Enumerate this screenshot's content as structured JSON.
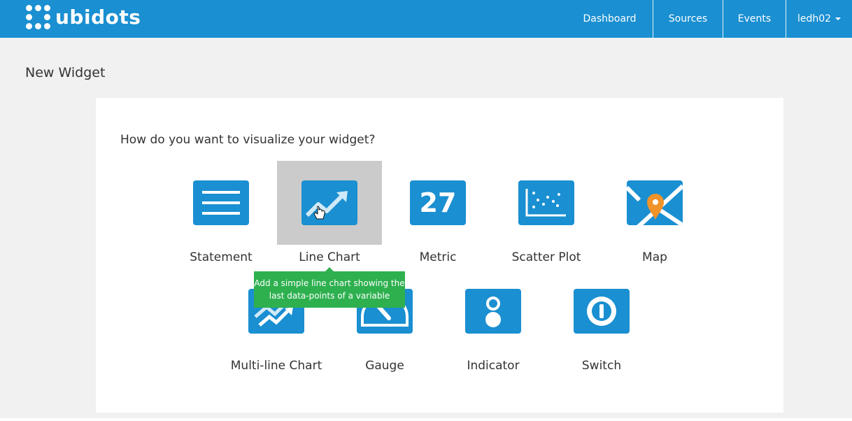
{
  "brand": {
    "name": "ubidots"
  },
  "nav": {
    "items": [
      {
        "label": "Dashboard"
      },
      {
        "label": "Sources"
      },
      {
        "label": "Events"
      },
      {
        "label": "ledh02"
      }
    ]
  },
  "page": {
    "title": "New Widget"
  },
  "card": {
    "question": "How do you want to visualize your widget?",
    "options": [
      {
        "label": "Statement",
        "icon": "statement-icon"
      },
      {
        "label": "Line Chart",
        "icon": "line-chart-icon"
      },
      {
        "label": "Metric",
        "icon": "metric-icon",
        "icon_text": "27"
      },
      {
        "label": "Scatter Plot",
        "icon": "scatter-plot-icon"
      },
      {
        "label": "Map",
        "icon": "map-icon"
      },
      {
        "label": "Multi-line Chart",
        "icon": "multi-line-chart-icon"
      },
      {
        "label": "Gauge",
        "icon": "gauge-icon"
      },
      {
        "label": "Indicator",
        "icon": "indicator-icon"
      },
      {
        "label": "Switch",
        "icon": "switch-icon"
      }
    ],
    "tooltip": "Add a simple line chart showing the last data-points of a variable"
  },
  "colors": {
    "brand_blue": "#1a8fd1",
    "tooltip_green": "#2eb04f",
    "map_pin": "#f0932b",
    "hover_gray": "#cbcbcb"
  }
}
